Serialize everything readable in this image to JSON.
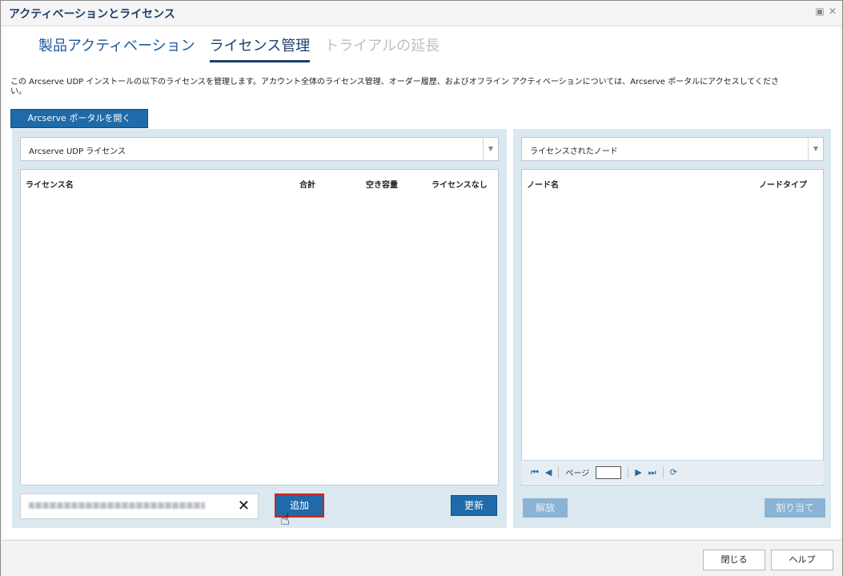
{
  "window": {
    "title": "アクティベーションとライセンス",
    "icons": [
      "minimize-icon",
      "close-icon"
    ]
  },
  "tabs": [
    {
      "label": "製品アクティベーション",
      "state": "normal"
    },
    {
      "label": "ライセンス管理",
      "state": "active"
    },
    {
      "label": "トライアルの延長",
      "state": "disabled"
    }
  ],
  "description": "この Arcserve UDP インストールの以下のライセンスを管理します。アカウント全体のライセンス管理、オーダー履歴、およびオフライン アクティベーションについては、Arcserve ポータルにアクセスしてください。",
  "portal_button": "Arcserve ポータルを開く",
  "left_panel": {
    "select_value": "Arcserve UDP ライセンス",
    "columns": [
      "ライセンス名",
      "合計",
      "空き容量",
      "ライセンスなし"
    ],
    "key_input_value": "",
    "add_label": "追加",
    "refresh_label": "更新"
  },
  "right_panel": {
    "select_value": "ライセンスされたノード",
    "columns": [
      "ノード名",
      "ノードタイプ"
    ],
    "pager": {
      "page_label": "ページ",
      "page_value": ""
    },
    "release_label": "解放",
    "assign_label": "割り当て"
  },
  "footer": {
    "close_label": "閉じる",
    "help_label": "ヘルプ"
  },
  "colors": {
    "primary": "#1f6aa8",
    "panel_bg": "#dbe8f0",
    "highlight": "#d4231d",
    "disabled_btn": "#8ab3d4"
  }
}
